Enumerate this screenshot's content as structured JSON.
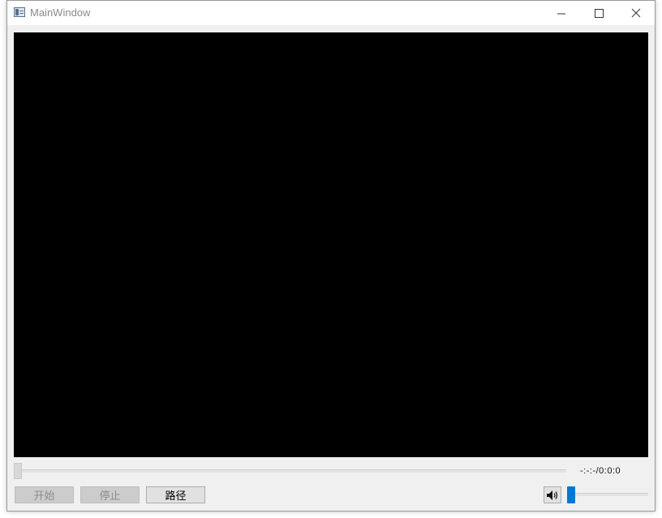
{
  "window": {
    "title": "MainWindow",
    "minimize_glyph": "—",
    "maximize_glyph": "☐",
    "close_glyph": "✕"
  },
  "player": {
    "time_display": "-:-:-/0:0:0",
    "seek_position": 0,
    "volume_level": 0
  },
  "controls": {
    "start_label": "开始",
    "stop_label": "停止",
    "path_label": "路径"
  },
  "colors": {
    "video_background": "#000000",
    "slider_accent": "#0078d7"
  },
  "icons": {
    "app": "app-window-icon",
    "volume": "speaker-volume-icon"
  }
}
